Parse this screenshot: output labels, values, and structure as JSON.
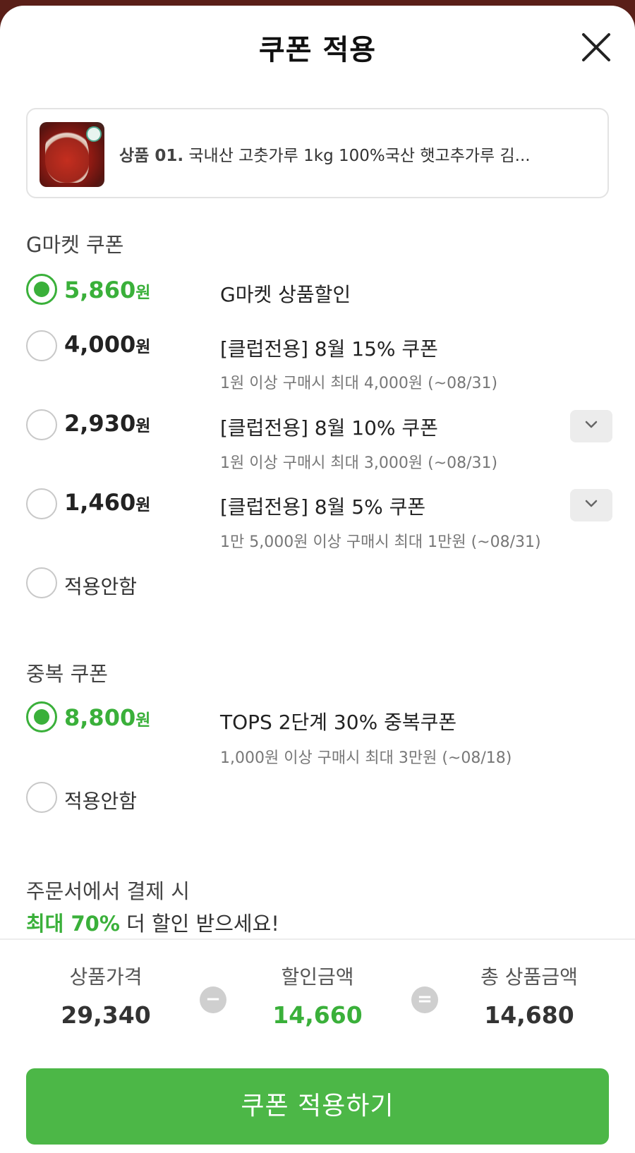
{
  "header": {
    "title": "쿠폰 적용",
    "close_icon": "close-icon"
  },
  "product": {
    "prefix": "상품 01.",
    "name": "국내산 고춧가루 1kg 100%국산 햇고추가루 김..."
  },
  "gmarket_section": {
    "label": "G마켓 쿠폰",
    "coupons": [
      {
        "amount": "5,860",
        "unit": "원",
        "name": "G마켓 상품할인",
        "desc": "",
        "selected": true,
        "expandable": false
      },
      {
        "amount": "4,000",
        "unit": "원",
        "name": "[클럽전용] 8월 15% 쿠폰",
        "desc": "1원 이상 구매시 최대 4,000원 (~08/31)",
        "selected": false,
        "expandable": false
      },
      {
        "amount": "2,930",
        "unit": "원",
        "name": "[클럽전용] 8월 10% 쿠폰",
        "desc": "1원 이상 구매시 최대 3,000원 (~08/31)",
        "selected": false,
        "expandable": true
      },
      {
        "amount": "1,460",
        "unit": "원",
        "name": "[클럽전용] 8월 5% 쿠폰",
        "desc": "1만 5,000원 이상 구매시 최대 1만원 (~08/31)",
        "selected": false,
        "expandable": true
      }
    ],
    "none_label": "적용안함"
  },
  "dup_section": {
    "label": "중복 쿠폰",
    "coupons": [
      {
        "amount": "8,800",
        "unit": "원",
        "name": "TOPS 2단계 30% 중복쿠폰",
        "desc": "1,000원 이상 구매시 최대 3만원 (~08/18)",
        "selected": true
      }
    ],
    "none_label": "적용안함"
  },
  "promo": {
    "line1": "주문서에서 결제 시",
    "highlight": "최대 70%",
    "line2_rest": " 더 할인 받으세요!"
  },
  "summary": {
    "price_label": "상품가격",
    "price_value": "29,340",
    "minus_symbol": "−",
    "discount_label": "할인금액",
    "discount_value": "14,660",
    "equals_symbol": "=",
    "total_label": "총 상품금액",
    "total_value": "14,680"
  },
  "apply_button": {
    "label": "쿠폰 적용하기"
  },
  "colors": {
    "accent": "#3ab03a",
    "button": "#4cb747"
  }
}
